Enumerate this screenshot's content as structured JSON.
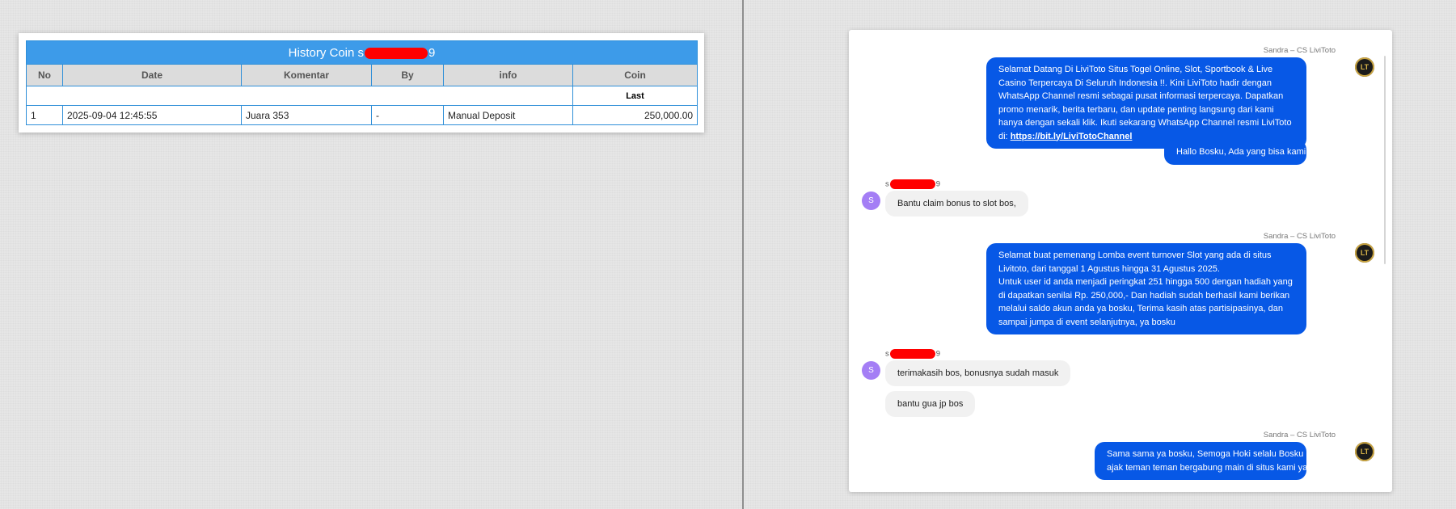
{
  "history": {
    "title_prefix": "History Coin s",
    "title_suffix": "9",
    "columns": [
      "No",
      "Date",
      "Komentar",
      "By",
      "info",
      "Coin"
    ],
    "sub_header": "Last",
    "rows": [
      {
        "no": "1",
        "date": "2025-09-04 12:45:55",
        "komentar": "Juara 353",
        "by": "-",
        "info": "Manual Deposit",
        "coin": "250,000.00"
      }
    ]
  },
  "chat": {
    "agent_name": "Sandra – CS LiviToto",
    "user_initial": "S",
    "user_name_prefix": "s",
    "user_name_suffix": "9",
    "msg1_text": "Selamat Datang Di LiviToto Situs Togel Online, Slot, Sportbook & Live Casino Terpercaya Di Seluruh Indonesia !!. Kini LiviToto hadir dengan WhatsApp Channel resmi sebagai pusat informasi terpercaya. Dapatkan promo menarik, berita terbaru, dan update penting langsung dari kami hanya dengan sekali klik. Ikuti sekarang WhatsApp Channel resmi LiviToto di: ",
    "msg1_link": "https://bit.ly/LiviTotoChannel",
    "msg2": "Hallo Bosku, Ada yang bisa kami bantu?",
    "user_msg1": "Bantu claim bonus to slot bos,",
    "msg3_line1": "Selamat buat pemenang Lomba event turnover Slot yang ada di situs Livitoto, dari tanggal 1 Agustus hingga 31 Agustus 2025.",
    "msg3_line2": "Untuk user id anda menjadi peringkat 251 hingga 500 dengan hadiah yang di dapatkan senilai Rp. 250,000,- Dan hadiah sudah berhasil kami berikan melalui saldo akun anda ya bosku, Terima kasih atas partisipasinya, dan sampai jumpa di event selanjutnya, ya bosku",
    "user_msg2": "terimakasih bos, bonusnya sudah masuk",
    "user_msg3": "bantu gua jp bos",
    "msg4_line1": "Sama sama ya bosku, Semoga Hoki selalu Bosku",
    "msg4_line2": "ajak teman teman bergabung main di situs kami ya bosku"
  },
  "colors": {
    "table_header": "#3d9be9",
    "redaction": "#ff0000",
    "agent_bubble": "#0758e6",
    "user_bubble": "#f1f1f1",
    "user_avatar": "#a47ef5",
    "coin_value": "#1c7a1c"
  },
  "icons": {
    "agent_avatar": "livitoto-logo-icon"
  }
}
